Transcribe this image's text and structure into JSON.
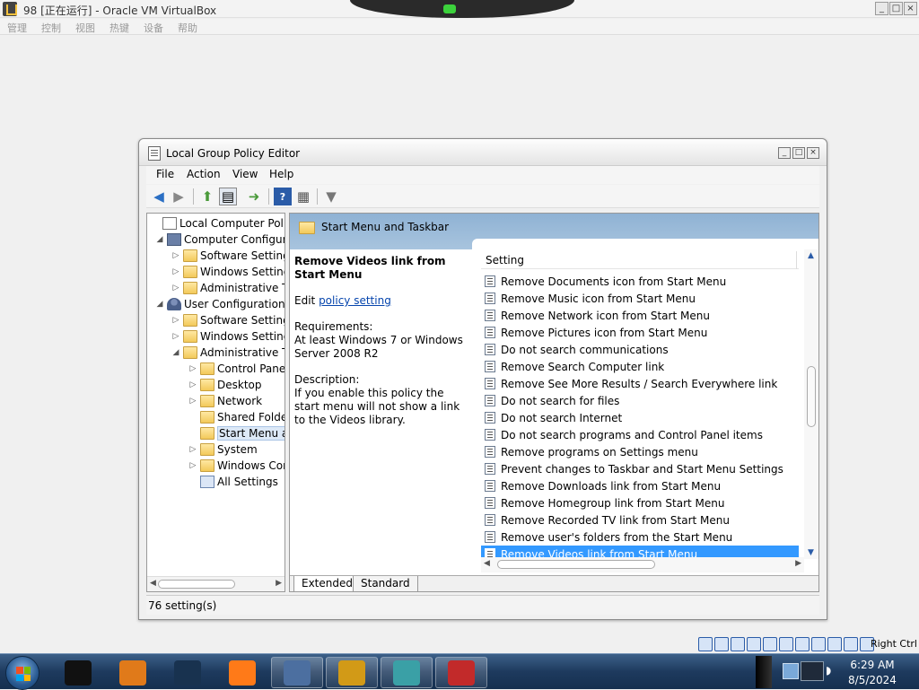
{
  "host": {
    "title": "98 [正在运行] - Oracle VM VirtualBox",
    "menu": [
      "管理",
      "控制",
      "视图",
      "热键",
      "设备",
      "帮助"
    ],
    "right_ctrl": "Right Ctrl",
    "window_buttons": [
      "_",
      "□",
      "×"
    ]
  },
  "gpe": {
    "title": "Local Group Policy Editor",
    "menu": [
      "File",
      "Action",
      "View",
      "Help"
    ],
    "window_buttons": [
      "_",
      "□",
      "×"
    ],
    "tree": [
      {
        "label": "Local Computer Policy",
        "icon": "policy-root-icon",
        "indent": 0,
        "expander": ""
      },
      {
        "label": "Computer Configura",
        "icon": "computer-icon",
        "indent": 1,
        "expander": "◢"
      },
      {
        "label": "Software Settings",
        "icon": "folder-icon",
        "indent": 2,
        "expander": "▷"
      },
      {
        "label": "Windows Setting",
        "icon": "folder-icon",
        "indent": 2,
        "expander": "▷"
      },
      {
        "label": "Administrative Te",
        "icon": "folder-icon",
        "indent": 2,
        "expander": "▷"
      },
      {
        "label": "User Configuration",
        "icon": "user-icon",
        "indent": 1,
        "expander": "◢"
      },
      {
        "label": "Software Settings",
        "icon": "folder-icon",
        "indent": 2,
        "expander": "▷"
      },
      {
        "label": "Windows Setting",
        "icon": "folder-icon",
        "indent": 2,
        "expander": "▷"
      },
      {
        "label": "Administrative Te",
        "icon": "folder-icon",
        "indent": 2,
        "expander": "◢"
      },
      {
        "label": "Control Panel",
        "icon": "folder-icon",
        "indent": 3,
        "expander": "▷"
      },
      {
        "label": "Desktop",
        "icon": "folder-icon",
        "indent": 3,
        "expander": "▷"
      },
      {
        "label": "Network",
        "icon": "folder-icon",
        "indent": 3,
        "expander": "▷"
      },
      {
        "label": "Shared Folder",
        "icon": "folder-icon",
        "indent": 3,
        "expander": ""
      },
      {
        "label": "Start Menu ar",
        "icon": "folder-icon",
        "indent": 3,
        "expander": "",
        "selected": true
      },
      {
        "label": "System",
        "icon": "folder-icon",
        "indent": 3,
        "expander": "▷"
      },
      {
        "label": "Windows Cor",
        "icon": "folder-icon",
        "indent": 3,
        "expander": "▷"
      },
      {
        "label": "All Settings",
        "icon": "settings-icon",
        "indent": 3,
        "expander": ""
      }
    ],
    "right_header": "Start Menu and Taskbar",
    "description": {
      "title": "Remove Videos link from Start Menu",
      "edit_prefix": "Edit ",
      "edit_link": "policy setting",
      "requirements_label": "Requirements:",
      "requirements_text": "At least Windows 7 or Windows Server 2008 R2",
      "description_label": "Description:",
      "description_text": "If you enable this policy the start menu will not show a link to the Videos library."
    },
    "settings_header": "Setting",
    "settings": [
      "Remove Documents icon from Start Menu",
      "Remove Music icon from Start Menu",
      "Remove Network icon from Start Menu",
      "Remove Pictures icon from Start Menu",
      "Do not search communications",
      "Remove Search Computer link",
      "Remove See More Results / Search Everywhere link",
      "Do not search for files",
      "Do not search Internet",
      "Do not search programs and Control Panel items",
      "Remove programs on Settings menu",
      "Prevent changes to Taskbar and Start Menu Settings",
      "Remove Downloads link from Start Menu",
      "Remove Homegroup link from Start Menu",
      "Remove Recorded TV link from Start Menu",
      "Remove user's folders from the Start Menu",
      "Remove Videos link from Start Menu"
    ],
    "selected_setting_index": 16,
    "tabs": [
      "Extended",
      "Standard"
    ],
    "status": "76 setting(s)"
  },
  "taskbar": {
    "apps": [
      {
        "name": "taskbar-app-terminal",
        "color": "#111111",
        "open": false
      },
      {
        "name": "taskbar-app-media-player",
        "color": "#e07a1a",
        "open": false
      },
      {
        "name": "taskbar-app-globe",
        "color": "#18324f",
        "open": false
      },
      {
        "name": "taskbar-app-firefox",
        "color": "#ff7a18",
        "open": false
      },
      {
        "name": "taskbar-app-virtualbox",
        "color": "#4c6fa0",
        "open": true
      },
      {
        "name": "taskbar-app-winamp",
        "color": "#d29a17",
        "open": true
      },
      {
        "name": "taskbar-app-cubes",
        "color": "#3aa0a6",
        "open": true
      },
      {
        "name": "taskbar-app-toolbox",
        "color": "#c22a2a",
        "open": true
      }
    ],
    "clock_time": "6:29 AM",
    "clock_date": "8/5/2024"
  }
}
